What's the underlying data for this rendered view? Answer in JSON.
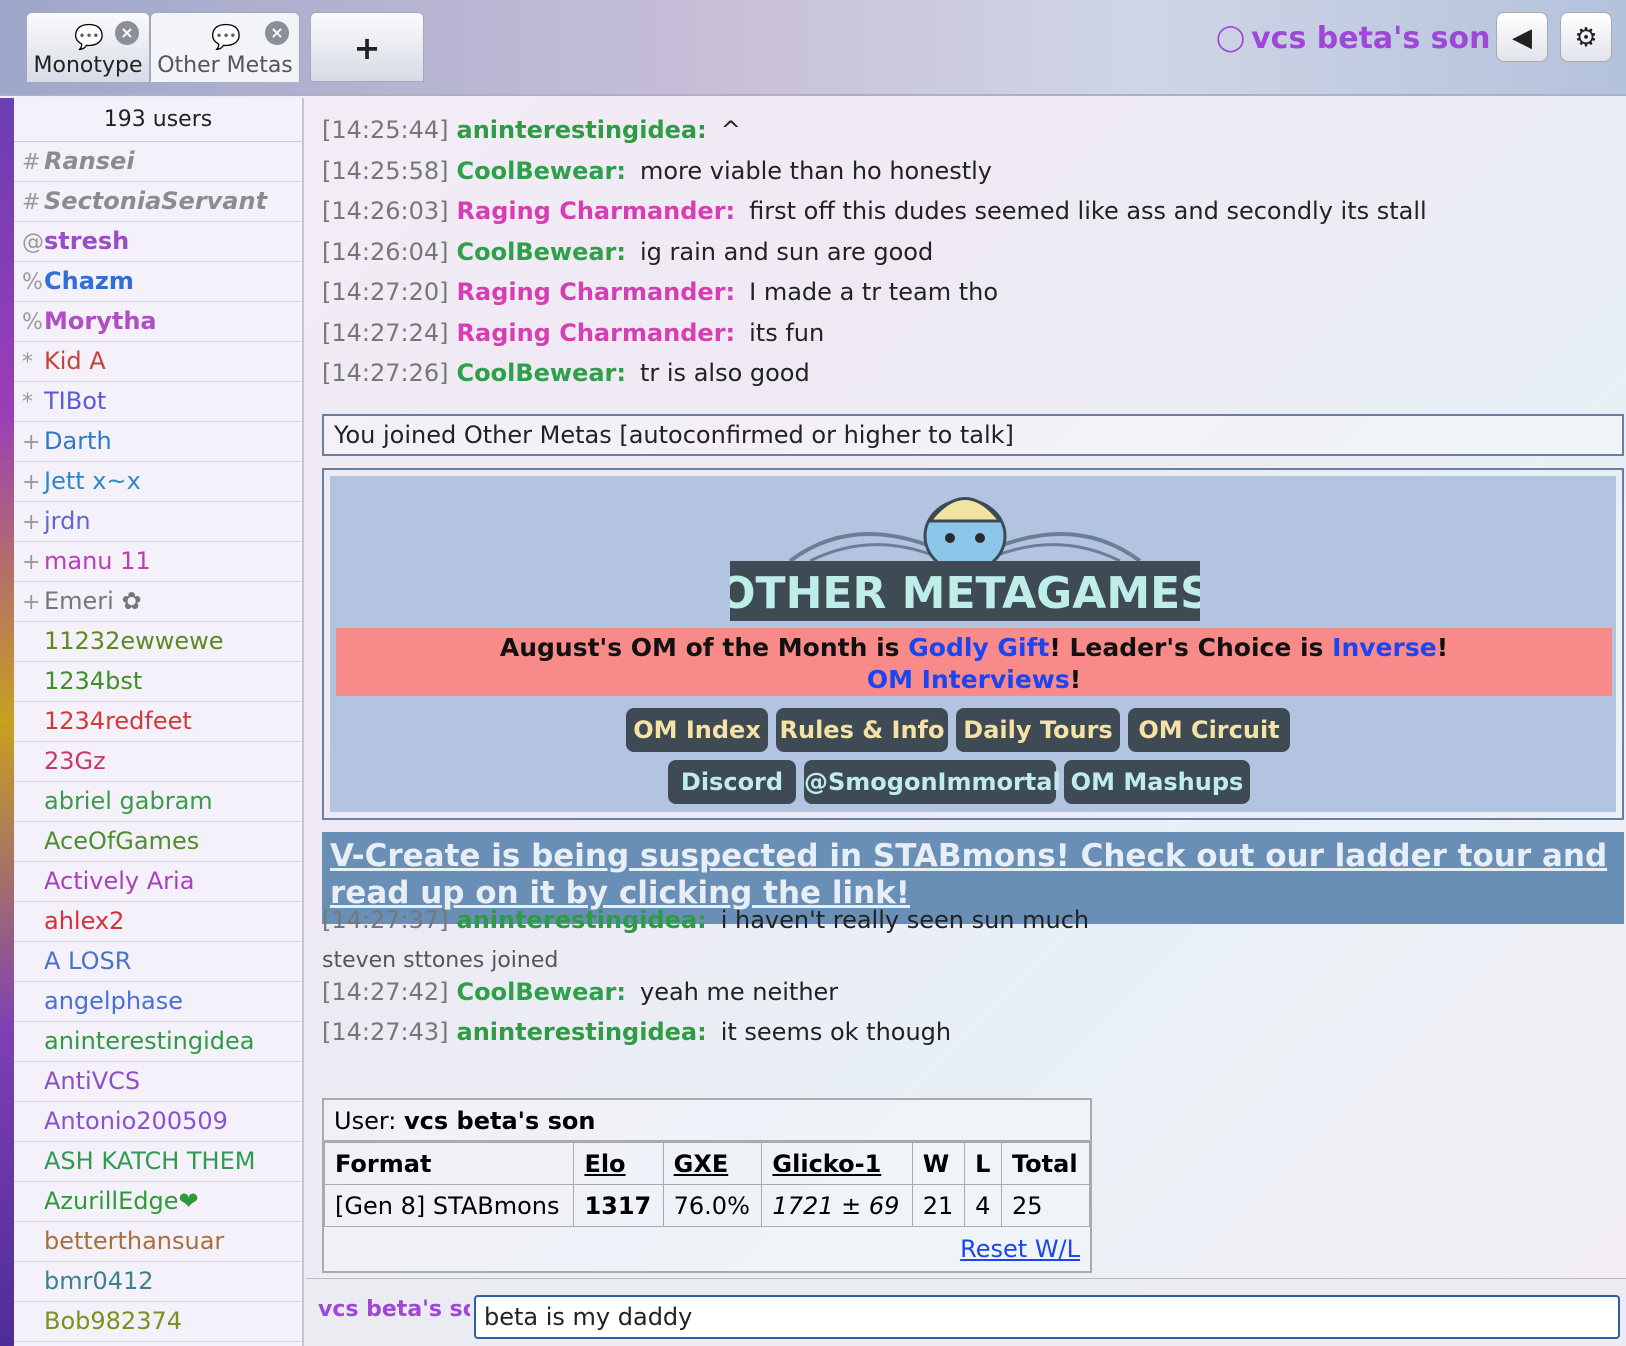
{
  "tabs": [
    {
      "label": "Monotype",
      "icon": "speech-bubble-icon"
    },
    {
      "label": "Other Metas",
      "icon": "speech-bubble-icon"
    }
  ],
  "tab_add_label": "+",
  "current_user": "vcs beta's son",
  "users": {
    "count_label": "193 users",
    "list": [
      {
        "rank": "#",
        "name": "Ransei",
        "color": "#8c8c8c",
        "style": "bi"
      },
      {
        "rank": "#",
        "name": "SectoniaServant",
        "color": "#8c8c8c",
        "style": "bi"
      },
      {
        "rank": "@",
        "name": "stresh",
        "color": "#9a4ec2",
        "style": "b"
      },
      {
        "rank": "%",
        "name": "Chazm",
        "color": "#2f6fd6",
        "style": "b"
      },
      {
        "rank": "%",
        "name": "Morytha",
        "color": "#b04fc4",
        "style": "b"
      },
      {
        "rank": "*",
        "name": "Kid A",
        "color": "#c0453a",
        "style": ""
      },
      {
        "rank": "*",
        "name": "TIBot",
        "color": "#5a5ad6",
        "style": ""
      },
      {
        "rank": "+",
        "name": "Darth",
        "color": "#2e79c8",
        "style": ""
      },
      {
        "rank": "+",
        "name": "Jett x~x",
        "color": "#2e87c8",
        "style": ""
      },
      {
        "rank": "+",
        "name": "jrdn",
        "color": "#5a6ad0",
        "style": ""
      },
      {
        "rank": "+",
        "name": "manu 11",
        "color": "#b83fb5",
        "style": ""
      },
      {
        "rank": "+",
        "name": "Emeri ✿",
        "color": "#777777",
        "style": ""
      },
      {
        "rank": "",
        "name": "11232ewwewe",
        "color": "#5c8a1e",
        "style": ""
      },
      {
        "rank": "",
        "name": "1234bst",
        "color": "#3f8f2a",
        "style": ""
      },
      {
        "rank": "",
        "name": "1234redfeet",
        "color": "#d23a3a",
        "style": ""
      },
      {
        "rank": "",
        "name": "23Gz",
        "color": "#c8396b",
        "style": ""
      },
      {
        "rank": "",
        "name": "abriel gabram",
        "color": "#3d9a4a",
        "style": ""
      },
      {
        "rank": "",
        "name": "AceOfGames",
        "color": "#4d8f2d",
        "style": ""
      },
      {
        "rank": "",
        "name": "Actively Aria",
        "color": "#a93fbf",
        "style": ""
      },
      {
        "rank": "",
        "name": "ahlex2",
        "color": "#d2303c",
        "style": ""
      },
      {
        "rank": "",
        "name": "A LOSR",
        "color": "#4a72c8",
        "style": ""
      },
      {
        "rank": "",
        "name": "angelphase",
        "color": "#4a6fd6",
        "style": ""
      },
      {
        "rank": "",
        "name": "aninterestingidea",
        "color": "#2e9b45",
        "style": ""
      },
      {
        "rank": "",
        "name": "AntiVCS",
        "color": "#8d4fc8",
        "style": ""
      },
      {
        "rank": "",
        "name": "Antonio200509",
        "color": "#8a52d0",
        "style": ""
      },
      {
        "rank": "",
        "name": "ASH KATCH THEM",
        "color": "#2f9a50",
        "style": ""
      },
      {
        "rank": "",
        "name": "AzurillEdge❤",
        "color": "#2e9a3a",
        "style": ""
      },
      {
        "rank": "",
        "name": "betterthansuar",
        "color": "#a8703a",
        "style": ""
      },
      {
        "rank": "",
        "name": "bmr0412",
        "color": "#3f7f8f",
        "style": ""
      },
      {
        "rank": "",
        "name": "Bob982374",
        "color": "#7f8f1e",
        "style": ""
      }
    ]
  },
  "messages_top": [
    {
      "time": "[14:25:44]",
      "nick": "aninterestingidea:",
      "color": "#2e9b45",
      "text": "^"
    },
    {
      "time": "[14:25:58]",
      "nick": "CoolBewear:",
      "color": "#2ea04a",
      "text": "more viable than ho honestly"
    },
    {
      "time": "[14:26:03]",
      "nick": "Raging Charmander:",
      "color": "#d63fb3",
      "text": "first off this dudes seemed like ass and secondly its stall"
    },
    {
      "time": "[14:26:04]",
      "nick": "CoolBewear:",
      "color": "#2ea04a",
      "text": "ig rain and sun are good"
    },
    {
      "time": "[14:27:20]",
      "nick": "Raging Charmander:",
      "color": "#d63fb3",
      "text": "I made a tr team tho"
    },
    {
      "time": "[14:27:24]",
      "nick": "Raging Charmander:",
      "color": "#d63fb3",
      "text": "its fun"
    },
    {
      "time": "[14:27:26]",
      "nick": "CoolBewear:",
      "color": "#2ea04a",
      "text": "tr is also good"
    }
  ],
  "join_notice": "You joined Other Metas [autoconfirmed or higher to talk]",
  "om_banner": {
    "logo_text": "OTHER METAGAMES",
    "line1_a": "August's OM of the Month is ",
    "line1_link1": "Godly Gift",
    "line1_b": "! Leader's Choice is ",
    "line1_link2": "Inverse",
    "line1_c": "!",
    "line2_link": "OM Interviews",
    "line2_c": "!",
    "buttons_row1": [
      "OM Index",
      "Rules & Info",
      "Daily Tours",
      "OM Circuit"
    ],
    "buttons_row2": [
      "Discord",
      "@SmogonImmortal",
      "OM Mashups"
    ]
  },
  "suspect_announcement": "V-Create is being suspected in STABmons! Check out our ladder tour and read up on it by clicking the link!",
  "messages_bottom": [
    {
      "time": "[14:27:37]",
      "nick": "aninterestingidea:",
      "color": "#2e9b45",
      "text": "i haven't really seen sun much"
    },
    {
      "time": "[14:27:42]",
      "nick": "CoolBewear:",
      "color": "#2ea04a",
      "text": "yeah me neither"
    },
    {
      "time": "[14:27:43]",
      "nick": "aninterestingidea:",
      "color": "#2e9b45",
      "text": "it seems ok though"
    }
  ],
  "join_event": "steven sttones joined",
  "rank_table": {
    "user_label": "User: ",
    "user_name": "vcs beta's son",
    "headers": [
      "Format",
      "Elo",
      "GXE",
      "Glicko-1",
      "W",
      "L",
      "Total"
    ],
    "row": {
      "format": "[Gen 8] STABmons",
      "elo": "1317",
      "gxe": "76.0%",
      "glicko": "1721 ± 69",
      "w": "21",
      "l": "4",
      "total": "25"
    },
    "reset_label": "Reset W/L"
  },
  "input": {
    "nick": "vcs beta's son",
    "value": "beta is my daddy"
  }
}
